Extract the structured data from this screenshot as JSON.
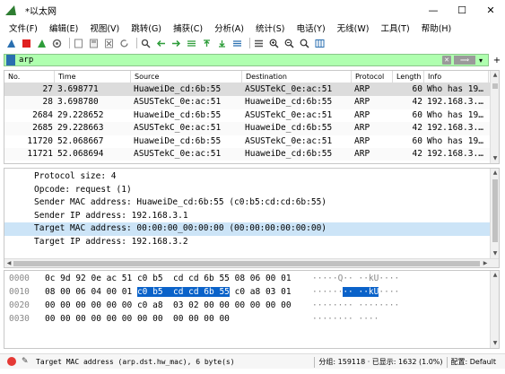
{
  "window": {
    "title": "*以太网",
    "minimize": "—",
    "maximize": "☐",
    "close": "✕"
  },
  "menu": [
    "文件(F)",
    "编辑(E)",
    "视图(V)",
    "跳转(G)",
    "捕获(C)",
    "分析(A)",
    "统计(S)",
    "电话(Y)",
    "无线(W)",
    "工具(T)",
    "帮助(H)"
  ],
  "toolbar_icons": [
    "fin-start-icon",
    "stop-icon",
    "restart-icon",
    "options-icon",
    "open-icon",
    "save-icon",
    "close-file-icon",
    "reload-icon",
    "find-icon",
    "back-icon",
    "forward-icon",
    "goto-icon",
    "first-icon",
    "last-icon",
    "autoscroll-icon",
    "colorize-icon",
    "zoom-in-icon",
    "zoom-out-icon",
    "normal-size-icon",
    "resize-columns-icon"
  ],
  "filter": {
    "value": "arp",
    "apply_label": "⟹"
  },
  "packet_list": {
    "columns": [
      "No.",
      "Time",
      "Source",
      "Destination",
      "Protocol",
      "Length",
      "Info"
    ],
    "rows": [
      {
        "no": "27",
        "time": "3.698771",
        "src": "HuaweiDe_cd:6b:55",
        "dst": "ASUSTekC_0e:ac:51",
        "proto": "ARP",
        "len": "60",
        "info": "Who has 19…",
        "selected": true
      },
      {
        "no": "28",
        "time": "3.698780",
        "src": "ASUSTekC_0e:ac:51",
        "dst": "HuaweiDe_cd:6b:55",
        "proto": "ARP",
        "len": "42",
        "info": "192.168.3.…"
      },
      {
        "no": "2684",
        "time": "29.228652",
        "src": "HuaweiDe_cd:6b:55",
        "dst": "ASUSTekC_0e:ac:51",
        "proto": "ARP",
        "len": "60",
        "info": "Who has 19…"
      },
      {
        "no": "2685",
        "time": "29.228663",
        "src": "ASUSTekC_0e:ac:51",
        "dst": "HuaweiDe_cd:6b:55",
        "proto": "ARP",
        "len": "42",
        "info": "192.168.3.…"
      },
      {
        "no": "11720",
        "time": "52.068667",
        "src": "HuaweiDe_cd:6b:55",
        "dst": "ASUSTekC_0e:ac:51",
        "proto": "ARP",
        "len": "60",
        "info": "Who has 19…"
      },
      {
        "no": "11721",
        "time": "52.068694",
        "src": "ASUSTekC_0e:ac:51",
        "dst": "HuaweiDe_cd:6b:55",
        "proto": "ARP",
        "len": "42",
        "info": "192.168.3.…"
      }
    ]
  },
  "details": [
    "Protocol size: 4",
    "Opcode: request (1)",
    "Sender MAC address: HuaweiDe_cd:6b:55 (c0:b5:cd:cd:6b:55)",
    "Sender IP address: 192.168.3.1",
    "Target MAC address: 00:00:00_00:00:00 (00:00:00:00:00:00)",
    "Target IP address: 192.168.3.2"
  ],
  "hex": [
    {
      "off": "0000",
      "pre": "0c 9d 92 0e ac 51 c0 b5  cd cd 6b 55 08 06 00 01",
      "sel": "",
      "post": "",
      "ascii_pre": "·····Q·· ··kU····",
      "ascii_sel": "",
      "ascii_post": ""
    },
    {
      "off": "0010",
      "pre": "08 00 06 04 00 01 ",
      "sel": "c0 b5  cd cd 6b 55",
      "post": " c0 a8 03 01",
      "ascii_pre": "······",
      "ascii_sel": "·· ··kU",
      "ascii_post": "····"
    },
    {
      "off": "0020",
      "pre": "00 00 00 00 00 00 c0 a8  03 02 00 00 00 00 00 00",
      "sel": "",
      "post": "",
      "ascii_pre": "········ ········",
      "ascii_sel": "",
      "ascii_post": ""
    },
    {
      "off": "0030",
      "pre": "00 00 00 00 00 00 00 00  00 00 00 00",
      "sel": "",
      "post": "",
      "ascii_pre": "········ ····",
      "ascii_sel": "",
      "ascii_post": ""
    }
  ],
  "status": {
    "field": "Target MAC address (arp.dst.hw_mac), 6 byte(s)",
    "packets": "分组: 159118 · 已显示: 1632 (1.0%)",
    "profile": "配置: Default"
  },
  "colors": {
    "filter_bg": "#afffaf",
    "selection": "#0a62c9",
    "detail_highlight": "#cce4f7"
  }
}
